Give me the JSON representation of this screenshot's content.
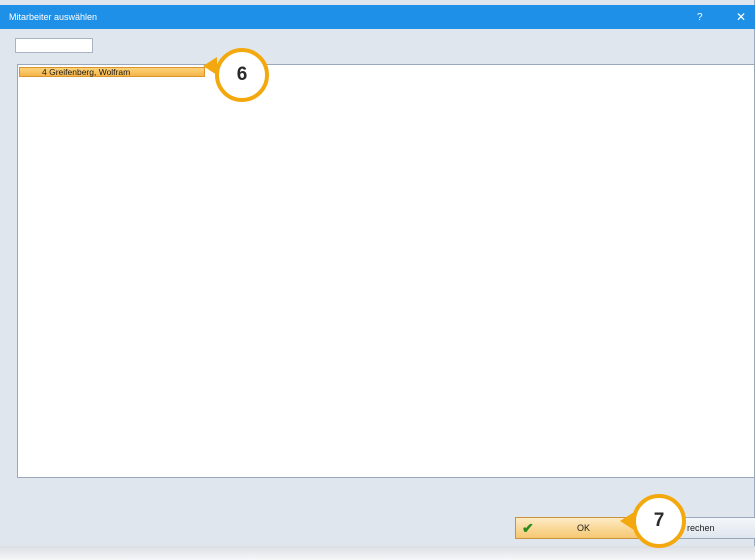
{
  "window": {
    "title": "Mitarbeiter auswählen",
    "help_label": "?",
    "close_label": "✕"
  },
  "search": {
    "value": "",
    "placeholder": ""
  },
  "list": {
    "rows": [
      {
        "label": "4 Greifenberg, Wolfram",
        "selected": true
      }
    ]
  },
  "buttons": {
    "ok_label": "OK",
    "cancel_label": "rechen"
  },
  "callouts": {
    "first": "6",
    "second": "7"
  },
  "colors": {
    "titlebar": "#1e90e8",
    "selection": "#f5b548",
    "callout_ring": "#f3a80e",
    "dialog_bg": "#dfe6ee"
  },
  "icons": {
    "ok": "checkmark-icon",
    "help": "help-icon",
    "close": "close-icon"
  }
}
